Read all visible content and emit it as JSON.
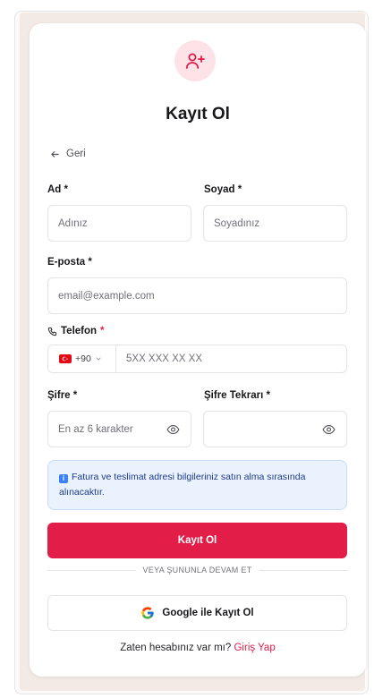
{
  "title": "Kayıt Ol",
  "back_label": "Geri",
  "fields": {
    "first_name": {
      "label": "Ad",
      "required_mark": "*",
      "placeholder": "Adınız"
    },
    "last_name": {
      "label": "Soyad",
      "required_mark": "*",
      "placeholder": "Soyadınız"
    },
    "email": {
      "label": "E-posta",
      "required_mark": "*",
      "placeholder": "email@example.com"
    },
    "phone": {
      "label": "Telefon",
      "required_mark": "*",
      "country_code": "+90",
      "placeholder": "5XX XXX XX XX"
    },
    "password": {
      "label": "Şifre",
      "required_mark": "*",
      "placeholder": "En az 6 karakter"
    },
    "password_confirm": {
      "label": "Şifre Tekrarı",
      "required_mark": "*",
      "placeholder": ""
    }
  },
  "info_text": "Fatura ve teslimat adresi bilgileriniz satın alma sırasında alınacaktır.",
  "submit_label": "Kayıt Ol",
  "divider_text": "VEYA ŞUNUNLA DEVAM ET",
  "google_label": "Google ile Kayıt Ol",
  "footer": {
    "text": "Zaten hesabınız var mı?",
    "link": "Giriş Yap"
  },
  "colors": {
    "accent": "#e11d48",
    "accent_light": "#fde3e8",
    "info_bg": "#eaf2fd",
    "backdrop": "#f3e9e5"
  }
}
